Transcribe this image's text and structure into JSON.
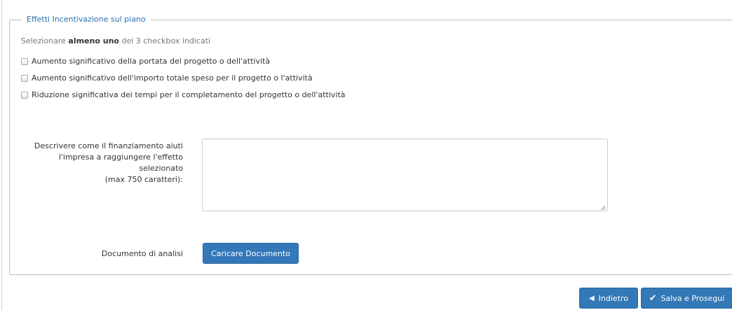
{
  "section": {
    "legend": "Effetti Incentivazione sul piano",
    "hint_prefix": "Selezionare ",
    "hint_bold": "almeno uno",
    "hint_suffix": " dei 3 checkbox indicati"
  },
  "checkboxes": [
    {
      "label": "Aumento significativo della portata del progetto o dell'attività",
      "checked": false
    },
    {
      "label": "Aumento significativo dell'importo totale speso per il progetto o l'attività",
      "checked": false
    },
    {
      "label": "Riduzione significativa dei tempi per il completamento del progetto o dell'attività",
      "checked": false
    }
  ],
  "description": {
    "label_line1": "Descrivere come il finanziamento aiuti",
    "label_line2": "l'impresa a raggiungere l'effetto selezionato",
    "label_line3": "(max 750 caratteri):",
    "value": ""
  },
  "document": {
    "label": "Documento di analisi",
    "upload_button": "Caricare Documento"
  },
  "footer": {
    "back_button": "Indietro",
    "back_icon": "caret-left-icon",
    "save_button": "Salva e Prosegui",
    "save_icon": "check-icon"
  },
  "colors": {
    "accent": "#3378b7",
    "legend_text": "#2a6fb0"
  }
}
